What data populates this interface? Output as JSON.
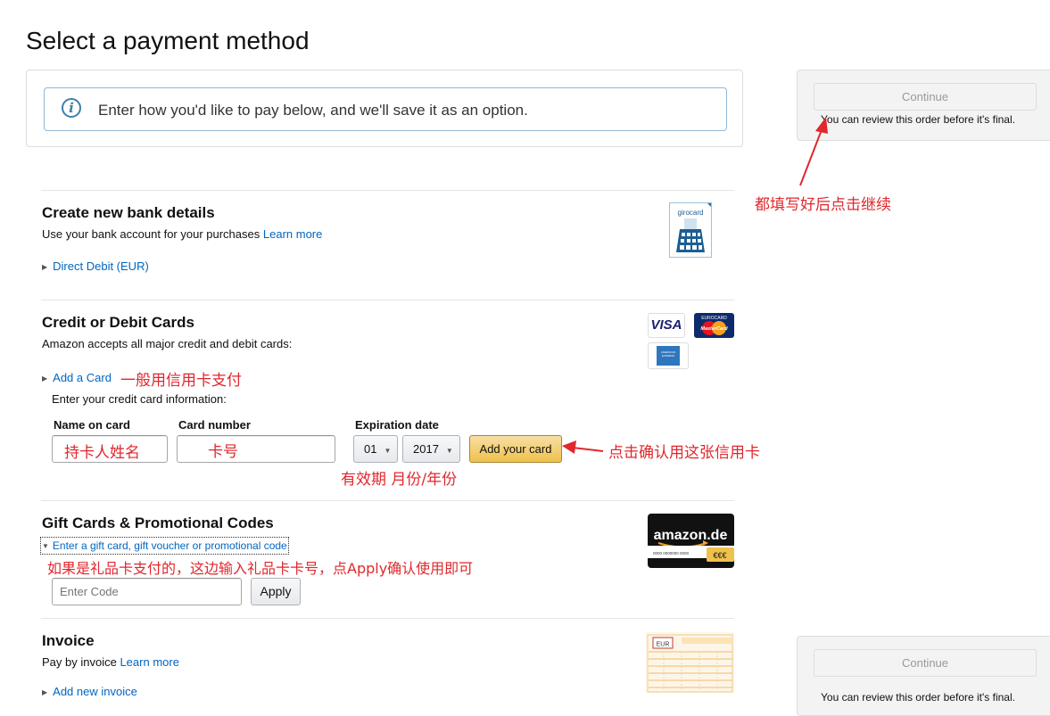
{
  "page_title": "Select a payment method",
  "info_banner": {
    "icon": "info-icon",
    "icon_glyph": "i",
    "text": "Enter how you'd like to pay below, and we'll save it as an option."
  },
  "side_panel": {
    "continue_label": "Continue",
    "note": "You can review this order before it's final."
  },
  "bank": {
    "title": "Create new bank details",
    "subtitle": "Use your bank account for your purchases",
    "learn_more": "Learn more",
    "option": "Direct Debit (EUR)",
    "logo_text": "girocard"
  },
  "cards": {
    "title": "Credit or Debit Cards",
    "subtitle": "Amazon accepts all major credit and debit cards:",
    "add_card": "Add a Card",
    "instruction": "Enter your credit card information:",
    "name_label": "Name on card",
    "number_label": "Card number",
    "expiry_label": "Expiration date",
    "month": "01",
    "year": "2017",
    "add_button": "Add your card",
    "logos": {
      "visa": "VISA",
      "mastercard": "MasterCard",
      "eurocard": "EUROCARD",
      "amex": "AMERICAN EXPRESS"
    }
  },
  "gift": {
    "title": "Gift Cards & Promotional Codes",
    "link": "Enter a gift card, gift voucher or promotional code",
    "placeholder": "Enter Code",
    "apply": "Apply",
    "logo_text": "amazon.de",
    "logo_badge": "€€€",
    "logo_number": "0000 0000000 0000"
  },
  "invoice": {
    "title": "Invoice",
    "subtitle": "Pay by invoice",
    "learn_more": "Learn more",
    "add": "Add new invoice",
    "logo_text": "EUR"
  },
  "annotations": {
    "continue_hint": "都填写好后点击继续",
    "card_hint": "一般用信用卡支付",
    "name_hint": "持卡人姓名",
    "number_hint": "卡号",
    "expiry_hint": "有效期 月份/年份",
    "confirm_hint": "点击确认用这张信用卡",
    "gift_hint": "如果是礼品卡支付的，这边输入礼品卡卡号，点Apply确认使用即可"
  },
  "colors": {
    "link": "#0066c0",
    "annotation": "#e0282d",
    "button_yellow": "#f0c14b"
  }
}
